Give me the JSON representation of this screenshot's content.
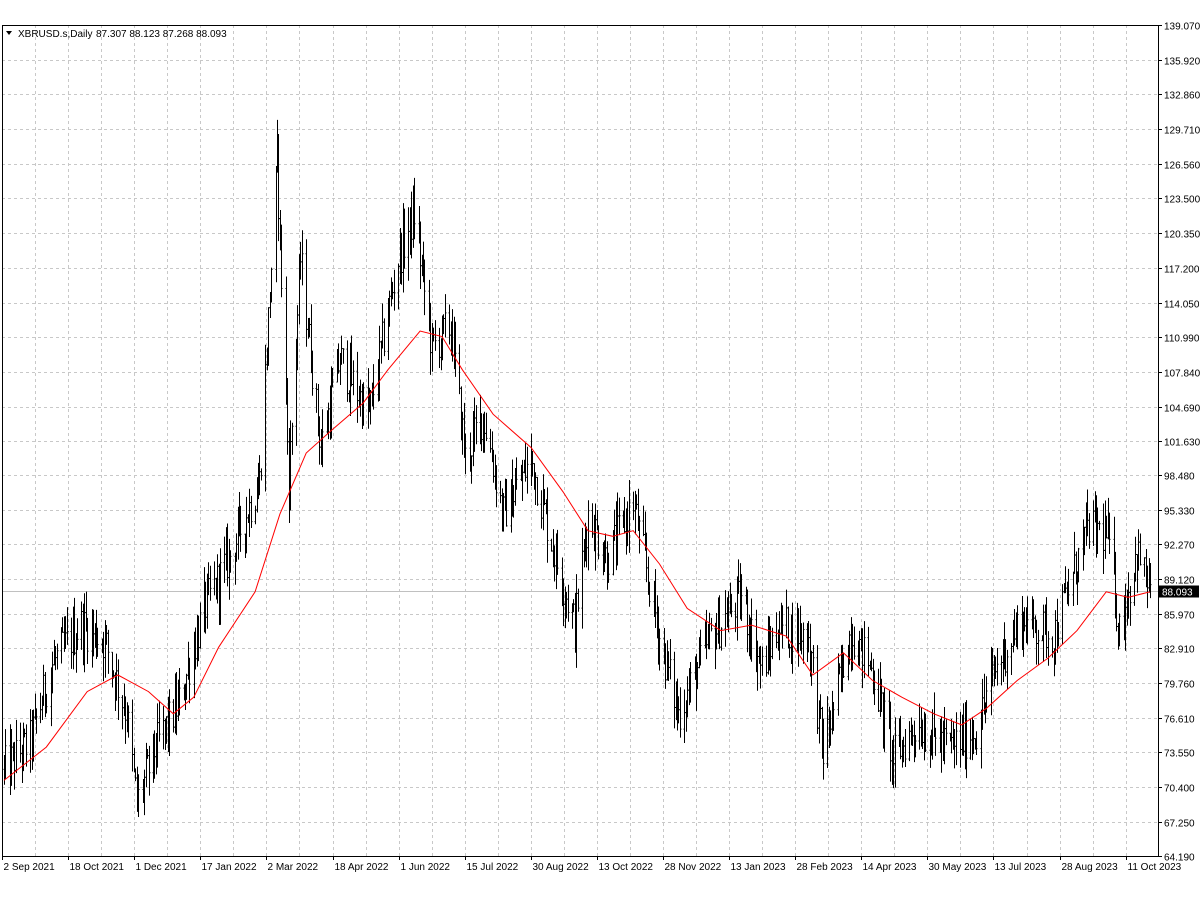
{
  "header": {
    "symbol_label": "XBRUSD.s,Daily",
    "ohlc_label": "87.307 88.123 87.268 88.093"
  },
  "colors": {
    "background": "#ffffff",
    "grid": "#c8c8c8",
    "bars": "#000000",
    "moving_average": "#ff0000",
    "price_line": "#c0c0c0",
    "price_tag_bg": "#000000",
    "price_tag_text": "#ffffff"
  },
  "chart_data": {
    "type": "bar",
    "title": "",
    "xlabel": "",
    "ylabel": "",
    "grid": true,
    "ylim": [
      64.19,
      139.07
    ],
    "y_ticks": [
      139.07,
      135.92,
      132.86,
      129.71,
      126.56,
      123.5,
      120.35,
      117.2,
      114.05,
      110.99,
      107.84,
      104.69,
      101.63,
      98.48,
      95.33,
      92.27,
      89.12,
      85.97,
      82.91,
      79.76,
      76.61,
      73.55,
      70.4,
      67.25,
      64.19
    ],
    "y_tick_labels": [
      "139.070",
      "135.920",
      "132.860",
      "129.710",
      "126.560",
      "123.500",
      "120.350",
      "117.200",
      "114.050",
      "110.990",
      "107.840",
      "104.690",
      "101.630",
      "98.480",
      "95.330",
      "92.270",
      "89.120",
      "85.970",
      "82.910",
      "79.760",
      "76.610",
      "73.550",
      "70.400",
      "67.250",
      "64.190"
    ],
    "x_tick_labels": [
      "2 Sep 2021",
      "18 Oct 2021",
      "1 Dec 2021",
      "17 Jan 2022",
      "2 Mar 2022",
      "18 Apr 2022",
      "1 Jun 2022",
      "15 Jul 2022",
      "30 Aug 2022",
      "13 Oct 2022",
      "28 Nov 2022",
      "13 Jan 2023",
      "28 Feb 2023",
      "14 Apr 2023",
      "30 May 2023",
      "13 Jul 2023",
      "28 Aug 2023",
      "11 Oct 2023"
    ],
    "last_price": 88.093,
    "last_price_label": "88.093",
    "series": [
      {
        "style": "ohlc-bars",
        "anchors": [
          {
            "date": "2021-09-02",
            "close": 72.0
          },
          {
            "date": "2021-09-20",
            "close": 74.5
          },
          {
            "date": "2021-10-05",
            "close": 81.5
          },
          {
            "date": "2021-10-25",
            "close": 85.0
          },
          {
            "date": "2021-11-10",
            "close": 83.5
          },
          {
            "date": "2021-11-25",
            "close": 77.0
          },
          {
            "date": "2021-12-02",
            "close": 69.0
          },
          {
            "date": "2021-12-15",
            "close": 74.0
          },
          {
            "date": "2021-12-31",
            "close": 78.0
          },
          {
            "date": "2022-01-17",
            "close": 86.5
          },
          {
            "date": "2022-02-03",
            "close": 91.0
          },
          {
            "date": "2022-02-24",
            "close": 98.0
          },
          {
            "date": "2022-03-08",
            "close": 127.0
          },
          {
            "date": "2022-03-16",
            "close": 98.0
          },
          {
            "date": "2022-03-24",
            "close": 118.0
          },
          {
            "date": "2022-04-07",
            "close": 101.0
          },
          {
            "date": "2022-04-20",
            "close": 109.0
          },
          {
            "date": "2022-05-10",
            "close": 104.0
          },
          {
            "date": "2022-05-30",
            "close": 118.0
          },
          {
            "date": "2022-06-10",
            "close": 122.0
          },
          {
            "date": "2022-06-22",
            "close": 110.0
          },
          {
            "date": "2022-07-05",
            "close": 112.0
          },
          {
            "date": "2022-07-15",
            "close": 100.0
          },
          {
            "date": "2022-07-27",
            "close": 104.0
          },
          {
            "date": "2022-08-10",
            "close": 95.0
          },
          {
            "date": "2022-08-29",
            "close": 100.0
          },
          {
            "date": "2022-09-15",
            "close": 91.0
          },
          {
            "date": "2022-09-28",
            "close": 85.0
          },
          {
            "date": "2022-10-07",
            "close": 95.0
          },
          {
            "date": "2022-10-20",
            "close": 91.0
          },
          {
            "date": "2022-11-07",
            "close": 96.0
          },
          {
            "date": "2022-11-25",
            "close": 84.0
          },
          {
            "date": "2022-12-08",
            "close": 77.0
          },
          {
            "date": "2022-12-30",
            "close": 84.0
          },
          {
            "date": "2023-01-20",
            "close": 87.5
          },
          {
            "date": "2023-02-03",
            "close": 81.0
          },
          {
            "date": "2023-02-15",
            "close": 85.0
          },
          {
            "date": "2023-03-07",
            "close": 84.0
          },
          {
            "date": "2023-03-17",
            "close": 73.5
          },
          {
            "date": "2023-04-05",
            "close": 84.5
          },
          {
            "date": "2023-04-20",
            "close": 81.0
          },
          {
            "date": "2023-05-04",
            "close": 73.0
          },
          {
            "date": "2023-05-20",
            "close": 76.0
          },
          {
            "date": "2023-06-12",
            "close": 74.0
          },
          {
            "date": "2023-06-30",
            "close": 75.5
          },
          {
            "date": "2023-07-13",
            "close": 81.0
          },
          {
            "date": "2023-07-31",
            "close": 85.5
          },
          {
            "date": "2023-08-22",
            "close": 84.0
          },
          {
            "date": "2023-09-15",
            "close": 94.0
          },
          {
            "date": "2023-09-28",
            "close": 93.0
          },
          {
            "date": "2023-10-06",
            "close": 84.5
          },
          {
            "date": "2023-10-18",
            "close": 91.5
          },
          {
            "date": "2023-10-27",
            "close": 88.0
          }
        ]
      },
      {
        "style": "moving-average",
        "points": [
          {
            "date": "2021-09-02",
            "value": 71.0
          },
          {
            "date": "2021-10-01",
            "value": 74.0
          },
          {
            "date": "2021-10-29",
            "value": 79.0
          },
          {
            "date": "2021-11-19",
            "value": 80.5
          },
          {
            "date": "2021-12-10",
            "value": 79.0
          },
          {
            "date": "2021-12-27",
            "value": 77.0
          },
          {
            "date": "2022-01-10",
            "value": 78.5
          },
          {
            "date": "2022-01-27",
            "value": 83.0
          },
          {
            "date": "2022-02-21",
            "value": 88.0
          },
          {
            "date": "2022-03-10",
            "value": 95.0
          },
          {
            "date": "2022-03-28",
            "value": 100.5
          },
          {
            "date": "2022-04-14",
            "value": 102.5
          },
          {
            "date": "2022-05-06",
            "value": 105.0
          },
          {
            "date": "2022-05-23",
            "value": 108.0
          },
          {
            "date": "2022-06-14",
            "value": 111.5
          },
          {
            "date": "2022-06-29",
            "value": 111.0
          },
          {
            "date": "2022-07-13",
            "value": 108.0
          },
          {
            "date": "2022-08-03",
            "value": 104.0
          },
          {
            "date": "2022-08-29",
            "value": 101.0
          },
          {
            "date": "2022-09-20",
            "value": 97.0
          },
          {
            "date": "2022-10-07",
            "value": 93.5
          },
          {
            "date": "2022-10-24",
            "value": 93.0
          },
          {
            "date": "2022-11-07",
            "value": 93.5
          },
          {
            "date": "2022-11-25",
            "value": 90.5
          },
          {
            "date": "2022-12-14",
            "value": 86.5
          },
          {
            "date": "2023-01-06",
            "value": 84.5
          },
          {
            "date": "2023-01-27",
            "value": 85.0
          },
          {
            "date": "2023-02-20",
            "value": 84.0
          },
          {
            "date": "2023-03-10",
            "value": 80.5
          },
          {
            "date": "2023-03-31",
            "value": 82.5
          },
          {
            "date": "2023-04-20",
            "value": 80.0
          },
          {
            "date": "2023-05-10",
            "value": 78.5
          },
          {
            "date": "2023-06-01",
            "value": 77.0
          },
          {
            "date": "2023-06-20",
            "value": 76.0
          },
          {
            "date": "2023-07-07",
            "value": 77.5
          },
          {
            "date": "2023-07-28",
            "value": 80.0
          },
          {
            "date": "2023-08-18",
            "value": 82.0
          },
          {
            "date": "2023-09-07",
            "value": 84.5
          },
          {
            "date": "2023-09-27",
            "value": 88.0
          },
          {
            "date": "2023-10-12",
            "value": 87.5
          },
          {
            "date": "2023-10-27",
            "value": 88.0
          }
        ]
      }
    ]
  }
}
